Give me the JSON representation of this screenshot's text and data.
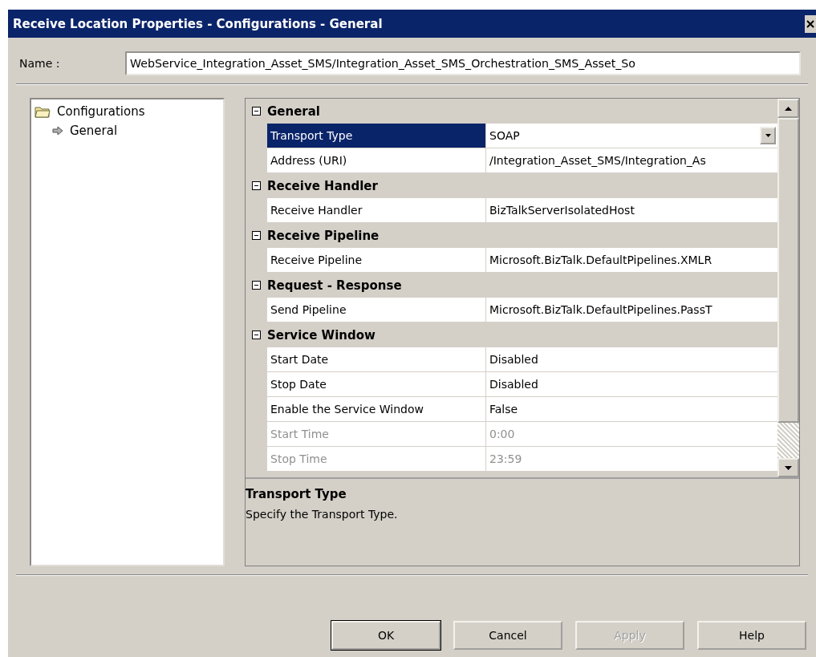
{
  "window": {
    "title": "Receive Location Properties - Configurations - General"
  },
  "name_field": {
    "label": "Name :",
    "value": "WebService_Integration_Asset_SMS/Integration_Asset_SMS_Orchestration_SMS_Asset_So"
  },
  "tree": [
    {
      "label": "Configurations",
      "kind": "folder",
      "children": [
        {
          "label": "General",
          "kind": "page"
        }
      ]
    }
  ],
  "property_groups": [
    {
      "title": "General",
      "expanded": true,
      "properties": [
        {
          "name": "Transport Type",
          "value": "SOAP",
          "kind": "dropdown",
          "selected": true,
          "disabled": false
        },
        {
          "name": "Address (URI)",
          "value": "/Integration_Asset_SMS/Integration_As",
          "kind": "text",
          "selected": false,
          "disabled": false
        }
      ]
    },
    {
      "title": "Receive Handler",
      "expanded": true,
      "properties": [
        {
          "name": "Receive Handler",
          "value": "BizTalkServerIsolatedHost",
          "kind": "text",
          "selected": false,
          "disabled": false
        }
      ]
    },
    {
      "title": "Receive Pipeline",
      "expanded": true,
      "properties": [
        {
          "name": "Receive Pipeline",
          "value": "Microsoft.BizTalk.DefaultPipelines.XMLR",
          "kind": "text",
          "selected": false,
          "disabled": false
        }
      ]
    },
    {
      "title": "Request - Response",
      "expanded": true,
      "properties": [
        {
          "name": "Send Pipeline",
          "value": "Microsoft.BizTalk.DefaultPipelines.PassT",
          "kind": "text",
          "selected": false,
          "disabled": false
        }
      ]
    },
    {
      "title": "Service Window",
      "expanded": true,
      "properties": [
        {
          "name": "Start Date",
          "value": "Disabled",
          "kind": "text",
          "selected": false,
          "disabled": false
        },
        {
          "name": "Stop Date",
          "value": "Disabled",
          "kind": "text",
          "selected": false,
          "disabled": false
        },
        {
          "name": "Enable the Service Window",
          "value": "False",
          "kind": "text",
          "selected": false,
          "disabled": false
        },
        {
          "name": "Start Time",
          "value": "0:00",
          "kind": "text",
          "selected": false,
          "disabled": true
        },
        {
          "name": "Stop Time",
          "value": "23:59",
          "kind": "text",
          "selected": false,
          "disabled": true
        }
      ]
    }
  ],
  "description": {
    "title": "Transport Type",
    "text": "Specify the Transport Type."
  },
  "buttons": [
    {
      "label": "OK",
      "default": true,
      "disabled": false
    },
    {
      "label": "Cancel",
      "default": false,
      "disabled": false
    },
    {
      "label": "Apply",
      "default": false,
      "disabled": true
    },
    {
      "label": "Help",
      "default": false,
      "disabled": false
    }
  ]
}
